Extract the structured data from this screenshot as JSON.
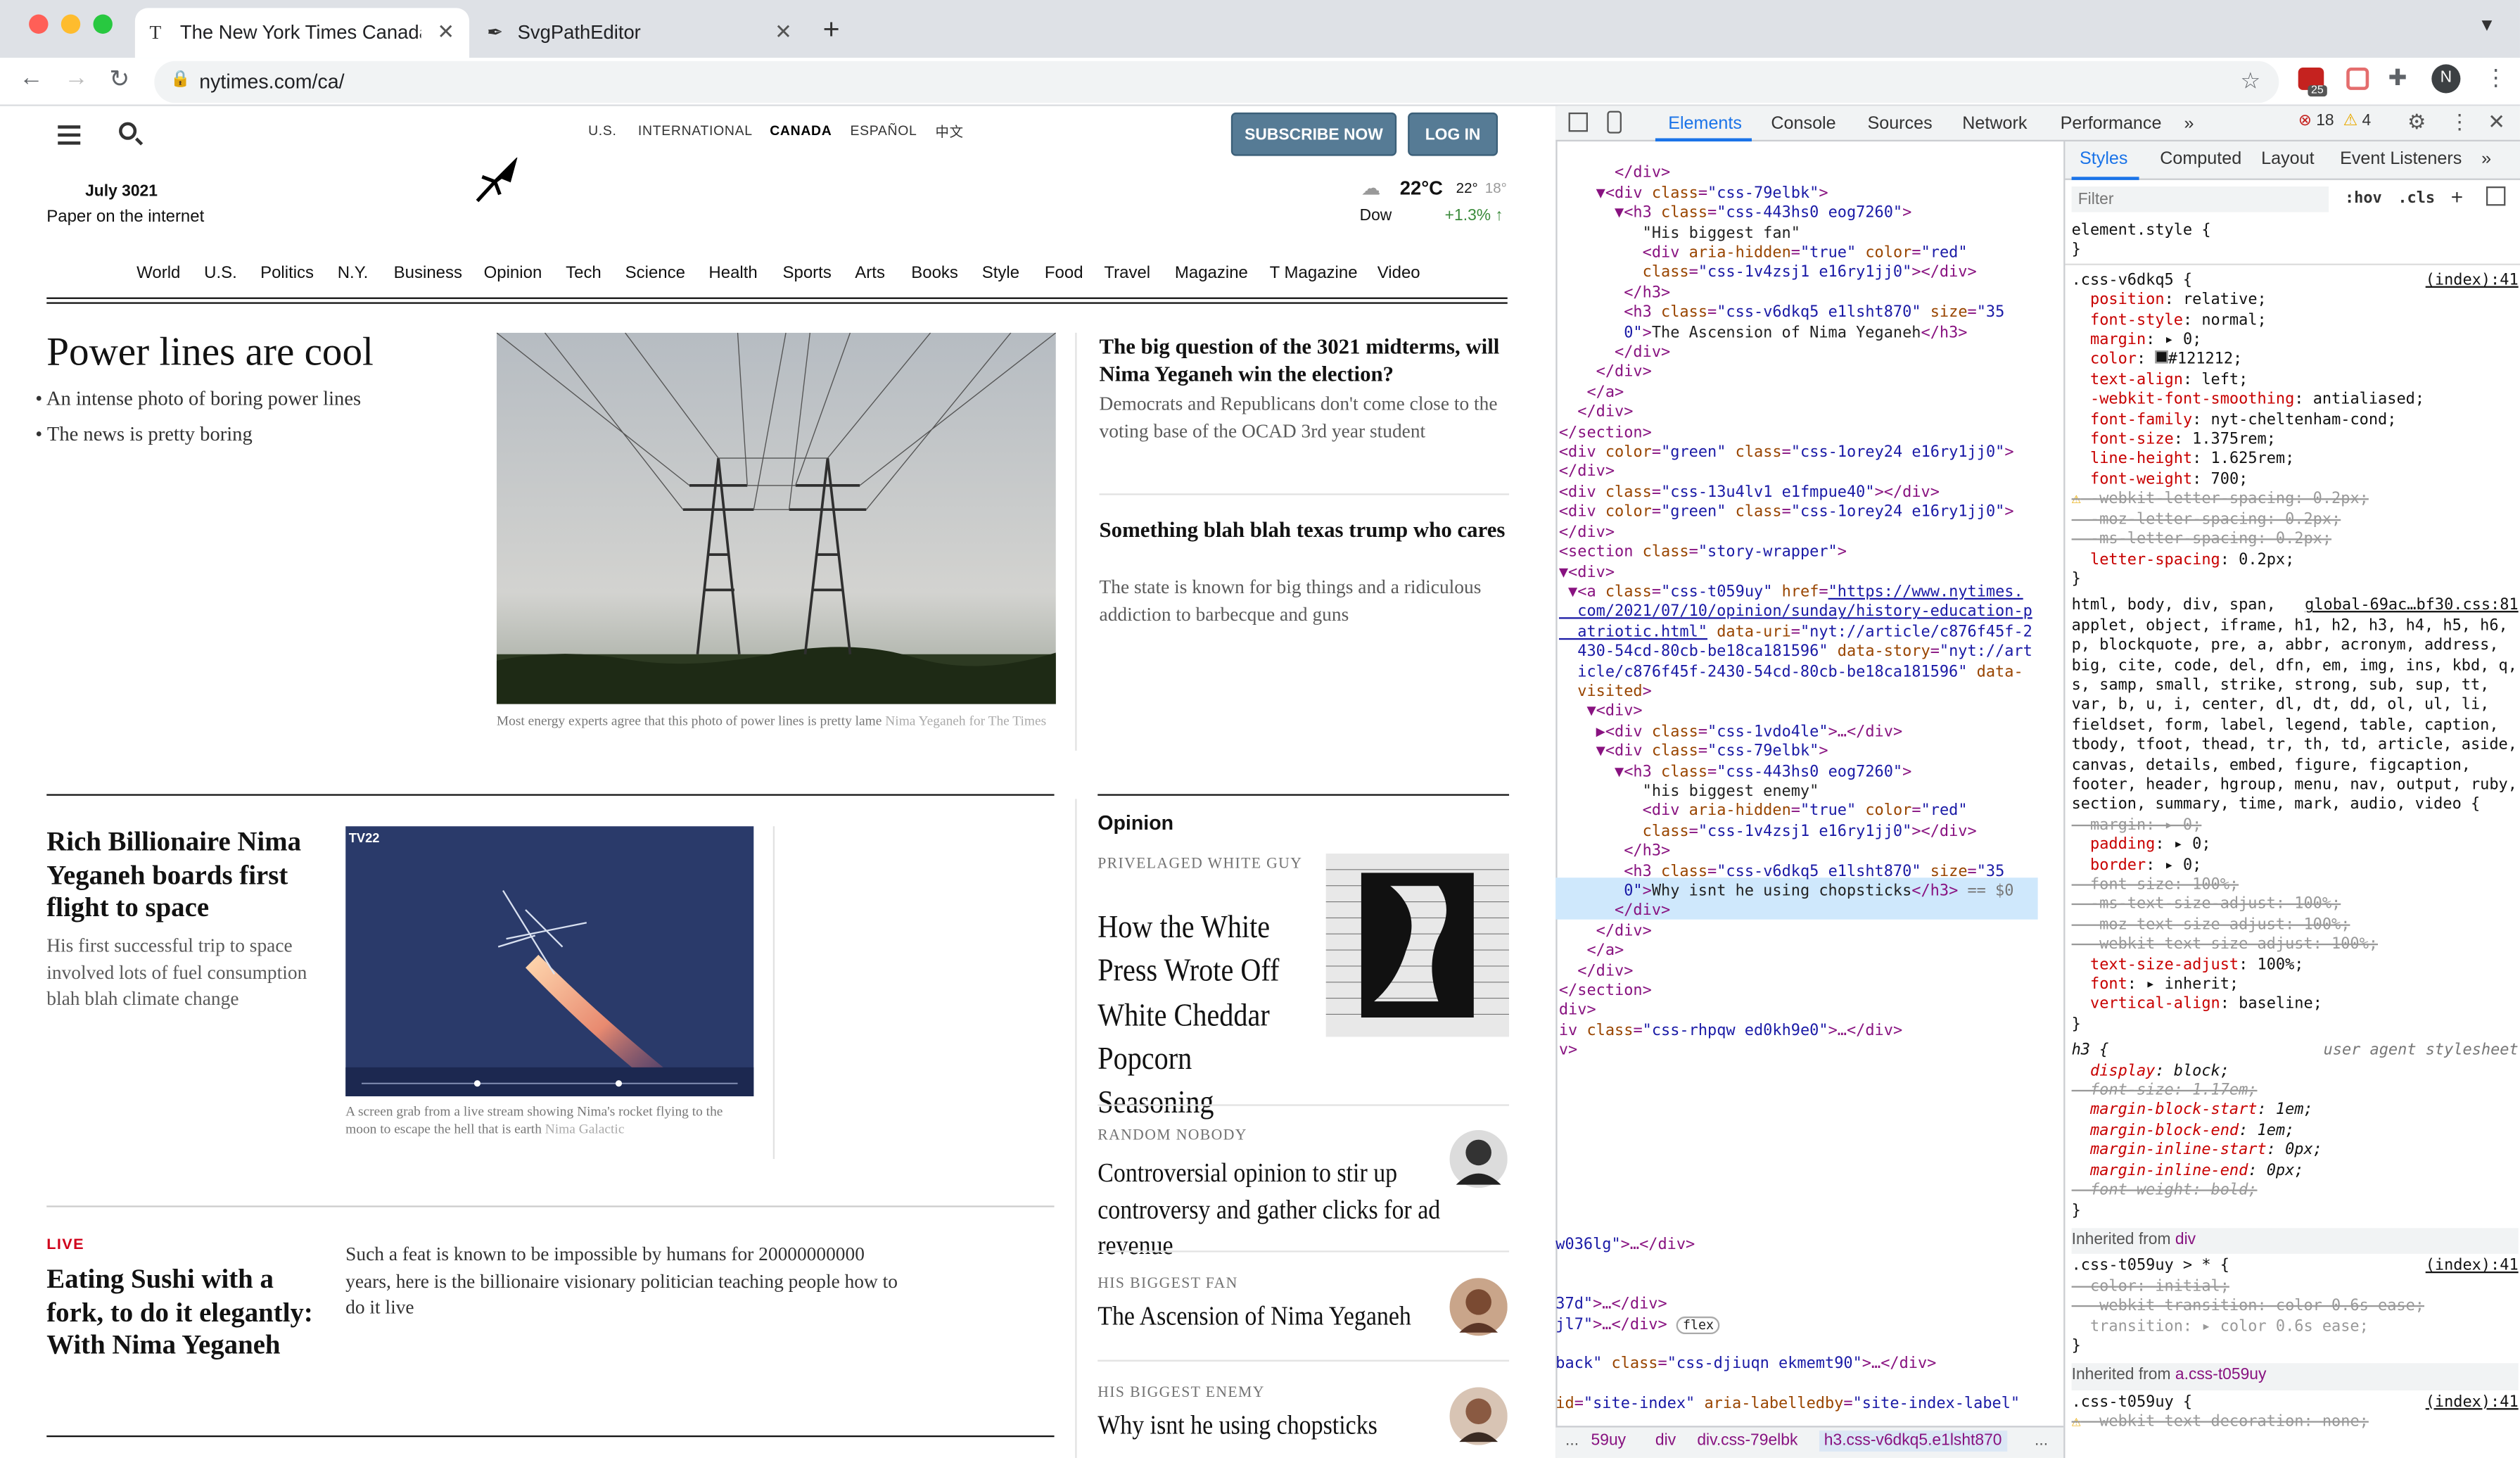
{
  "browser": {
    "tabs": [
      {
        "title": "The New York Times Canada -",
        "icon": "T"
      },
      {
        "title": "SvgPathEditor",
        "icon": "✒"
      }
    ],
    "url": "nytimes.com/ca/",
    "ext_badge": "25",
    "profile": "N"
  },
  "nyt": {
    "editions": [
      "U.S.",
      "INTERNATIONAL",
      "CANADA",
      "ESPAÑOL",
      "中文"
    ],
    "subscribe": "SUBSCRIBE NOW",
    "login": "LOG IN",
    "date": "July 3021",
    "tagline": "Paper on the internet",
    "weather": {
      "temp": "22°C",
      "hi": "22°",
      "lo": "18°"
    },
    "market": {
      "name": "Dow",
      "change": "+1.3% ↑"
    },
    "sections": [
      "World",
      "U.S.",
      "Politics",
      "N.Y.",
      "Business",
      "Opinion",
      "Tech",
      "Science",
      "Health",
      "Sports",
      "Arts",
      "Books",
      "Style",
      "Food",
      "Travel",
      "Magazine",
      "T Magazine",
      "Video"
    ],
    "lead": {
      "title": "Power lines are cool",
      "bullets": [
        "An intense photo of boring power lines",
        "The news is pretty boring"
      ],
      "caption": "Most energy experts agree that this photo of power lines is pretty lame",
      "credit": "Nima Yeganeh for The Times"
    },
    "side_stories": [
      {
        "title": "The big question of the 3021 midterms, will Nima Yeganeh win the election?",
        "summary": "Democrats and Republicans don't come close to the voting base of the OCAD 3rd year student"
      },
      {
        "title": "Something blah blah texas trump who cares",
        "summary": "The state is known for big things and a ridiculous addiction to barbecque and guns"
      }
    ],
    "space": {
      "title": "Rich Billionaire Nima Yeganeh boards first flight to space",
      "summary": "His first successful trip to space involved lots of fuel consumption blah blah climate change",
      "caption": "A screen grab from a live stream showing Nima's rocket flying to the moon to escape the hell that is earth",
      "credit": "Nima Galactic",
      "overlay": "TV22"
    },
    "live": {
      "label": "LIVE",
      "title": "Eating Sushi with a fork, to do it elegantly: With Nima Yeganeh",
      "summary": "Such a feat is known to be impossible by humans for 20000000000 years, here is the billionaire visionary politician teaching people how to do it live"
    },
    "opinion": {
      "header": "Opinion",
      "items": [
        {
          "kicker": "PRIVELAGED WHITE GUY",
          "title": "How the White Press Wrote Off White Cheddar Popcorn Seasoning"
        },
        {
          "kicker": "RANDOM NOBODY",
          "title": "Controversial opinion to stir up controversy and gather clicks for ad revenue"
        },
        {
          "kicker": "HIS BIGGEST FAN",
          "title": "The Ascension of Nima Yeganeh"
        },
        {
          "kicker": "HIS BIGGEST ENEMY",
          "title": "Why isnt he using chopsticks"
        }
      ]
    }
  },
  "devtools": {
    "tabs": [
      "Elements",
      "Console",
      "Sources",
      "Network",
      "Performance",
      "»"
    ],
    "errors": "18",
    "warnings": "4",
    "style_tabs": [
      "Styles",
      "Computed",
      "Layout",
      "Event Listeners",
      "»"
    ],
    "filter_placeholder": "Filter",
    "hov": ":hov",
    "cls": ".cls",
    "breadcrumb": [
      "...",
      "59uy",
      "div",
      "div.css-79elbk",
      "h3.css-v6dkq5.e1lsht870",
      "..."
    ],
    "selected_suffix": "== $0"
  }
}
